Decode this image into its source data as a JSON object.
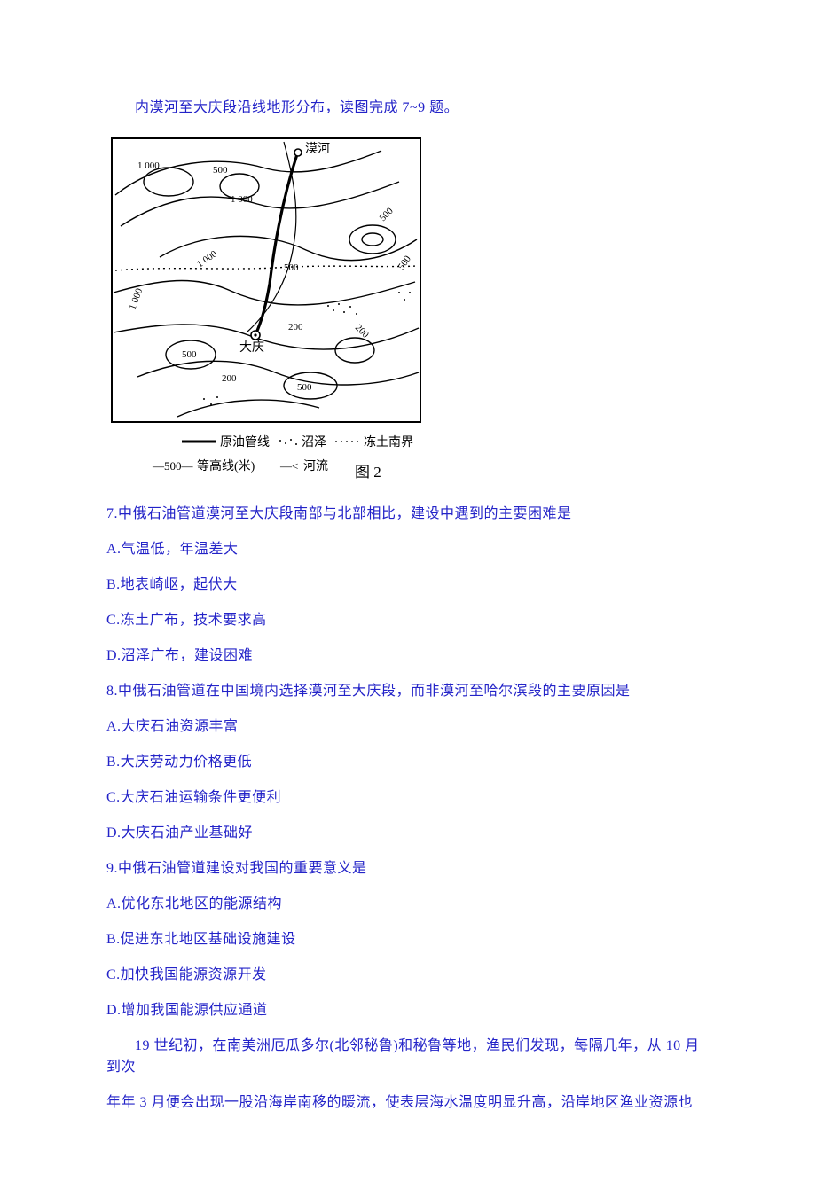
{
  "intro": "内漠河至大庆段沿线地形分布，读图完成 7~9 题。",
  "figure": {
    "labels": {
      "mohe": "漠河",
      "daqing": "大庆",
      "c1000a": "1 000",
      "c1000b": "1 000",
      "c1000c": "1 000",
      "c1000d": "1 000",
      "c500a": "500",
      "c500b": "500",
      "c500c": "500",
      "c500d": "500",
      "c500e": "500",
      "c500f": "500",
      "c200a": "200",
      "c200b": "200",
      "c200c": "200"
    },
    "legend": {
      "pipeline": "原油管线",
      "swamp": "沼泽",
      "frost": "冻土南界",
      "contour_label": "等高线(米)",
      "contour_value": "—500—",
      "river": "河流",
      "river_symbol": "—<",
      "caption": "图 2"
    }
  },
  "q7": {
    "stem": "7.中俄石油管道漠河至大庆段南部与北部相比，建设中遇到的主要困难是",
    "A": "A.气温低，年温差大",
    "B": "B.地表崎岖，起伏大",
    "C": "C.冻土广布，技术要求高",
    "D": "D.沼泽广布，建设困难"
  },
  "q8": {
    "stem": "8.中俄石油管道在中国境内选择漠河至大庆段，而非漠河至哈尔滨段的主要原因是",
    "A": "A.大庆石油资源丰富",
    "B": "B.大庆劳动力价格更低",
    "C": "C.大庆石油运输条件更便利",
    "D": "D.大庆石油产业基础好"
  },
  "q9": {
    "stem": "9.中俄石油管道建设对我国的重要意义是",
    "A": "A.优化东北地区的能源结构",
    "B": "B.促进东北地区基础设施建设",
    "C": "C.加快我国能源资源开发",
    "D": "D.增加我国能源供应通道"
  },
  "passage_line1": "19 世纪初，在南美洲厄瓜多尔(北邻秘鲁)和秘鲁等地，渔民们发现，每隔几年，从 10 月到次",
  "passage_line2": "年年 3 月便会出现一股沿海岸南移的暖流，使表层海水温度明显升高，沿岸地区渔业资源也"
}
